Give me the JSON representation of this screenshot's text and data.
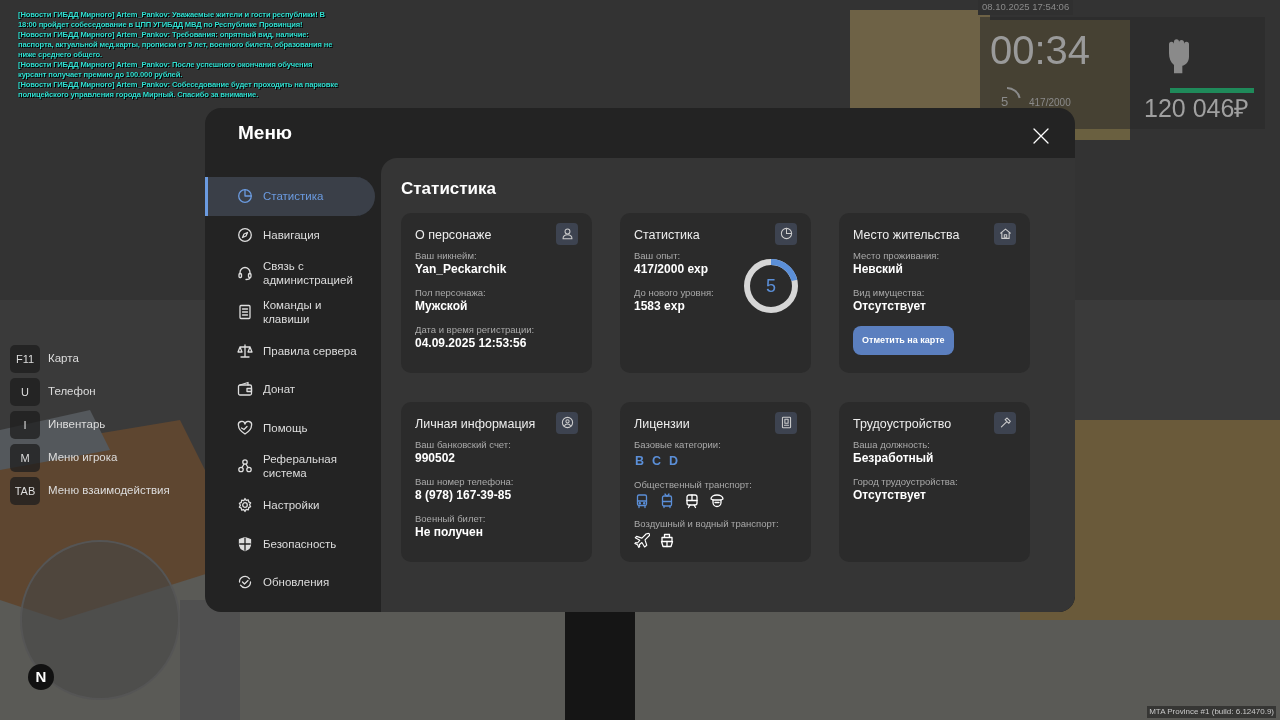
{
  "chat": {
    "messages": [
      "[Новости ГИБДД Мирного] Artem_Pankov: Уважаемые жители и гости республики! В 18:00 пройдет собеседование в ЦПП УГИБДД МВД по Республике Провинция!",
      "[Новости ГИБДД Мирного] Artem_Pankov: Требования: опрятный вид, наличие: паспорта, актуальной мед.карты, прописки от 5 лет, военного билета, образования не ниже среднего общего.",
      "[Новости ГИБДД Мирного] Artem_Pankov: После успешного окончания обучения курсант получает премию до 100.000 рублей.",
      "[Новости ГИБДД Мирного] Artem_Pankov: Собеседование будет проходить на парковке полицейского управления города Мирный. Спасибо за внимание."
    ]
  },
  "hud": {
    "datetime": "08.10.2025 17:54:06",
    "timer": "00:34",
    "player_level": "5",
    "exp": "417/2000",
    "health": {
      "level": 1
    },
    "money": "120 046₽"
  },
  "hotkeys": [
    {
      "key": "F11",
      "label": "Карта"
    },
    {
      "key": "U",
      "label": "Телефон"
    },
    {
      "key": "I",
      "label": "Инвентарь"
    },
    {
      "key": "M",
      "label": "Меню игрока"
    },
    {
      "key": "TAB",
      "label": "Меню взаимодействия"
    }
  ],
  "minimap": {
    "north": "N"
  },
  "menu": {
    "title": "Меню",
    "sidebar": {
      "items": [
        {
          "label": "Статистика",
          "selected": true
        },
        {
          "label": "Навигация",
          "selected": false
        },
        {
          "label": "Связь с администрацией",
          "selected": false
        },
        {
          "label": "Команды и клавиши",
          "selected": false
        },
        {
          "label": "Правила сервера",
          "selected": false
        },
        {
          "label": "Донат",
          "selected": false
        },
        {
          "label": "Помощь",
          "selected": false
        },
        {
          "label": "Реферальная система",
          "selected": false
        },
        {
          "label": "Настройки",
          "selected": false
        },
        {
          "label": "Безопасность",
          "selected": false
        },
        {
          "label": "Обновления",
          "selected": false
        }
      ]
    },
    "page_title": "Статистика",
    "cards": [
      {
        "kind": "info",
        "title": "О персонаже",
        "fields": [
          {
            "label": "Ваш никнейм:",
            "value": "Yan_Peckarchik"
          },
          {
            "label": "Пол персонажа:",
            "value": "Мужской"
          },
          {
            "label": "Дата и время регистрации:",
            "value": "04.09.2025 12:53:56"
          }
        ]
      },
      {
        "kind": "stats",
        "title": "Статистика",
        "fields": [
          {
            "label": "Ваш опыт:",
            "value": "417/2000 exp"
          },
          {
            "label": "До нового уровня:",
            "value": "1583 exp"
          }
        ],
        "ring": {
          "text": "5"
        }
      },
      {
        "kind": "info",
        "title": "Место жительства",
        "fields": [
          {
            "label": "Место проживания:",
            "value": "Невский"
          },
          {
            "label": "Вид имущества:",
            "value": "Отсутствует"
          }
        ],
        "button": "Отметить на карте"
      },
      {
        "kind": "info",
        "title": "Личная информация",
        "fields": [
          {
            "label": "Ваш банковский счет:",
            "value": "990502"
          },
          {
            "label": "Ваш номер телефона:",
            "value": "8 (978) 167-39-85"
          },
          {
            "label": "Военный билет:",
            "value": "Не получен"
          }
        ]
      },
      {
        "kind": "licenses",
        "title": "Лицензии",
        "sections": [
          {
            "label": "Базовые категории:",
            "letters": [
              {
                "label": "B",
                "active": true
              },
              {
                "label": "C",
                "active": true
              },
              {
                "label": "D",
                "active": true
              }
            ]
          },
          {
            "label": "Общественный транспорт:",
            "icons": [
              {
                "kind": "bus",
                "active": true
              },
              {
                "kind": "trolleybus",
                "active": true
              },
              {
                "kind": "train",
                "active": false
              },
              {
                "kind": "cap",
                "active": false
              }
            ]
          },
          {
            "label": "Воздушный и водный транспорт:",
            "icons": [
              {
                "kind": "plane",
                "active": false
              },
              {
                "kind": "ship",
                "active": false
              }
            ]
          }
        ]
      },
      {
        "kind": "info",
        "title": "Трудоустройство",
        "fields": [
          {
            "label": "Ваша должность:",
            "value": "Безработный"
          },
          {
            "label": "Город трудоустройства:",
            "value": "Отсутствует"
          }
        ]
      }
    ]
  },
  "footer": "MTA Province #1 (build: 6.12470.9)"
}
